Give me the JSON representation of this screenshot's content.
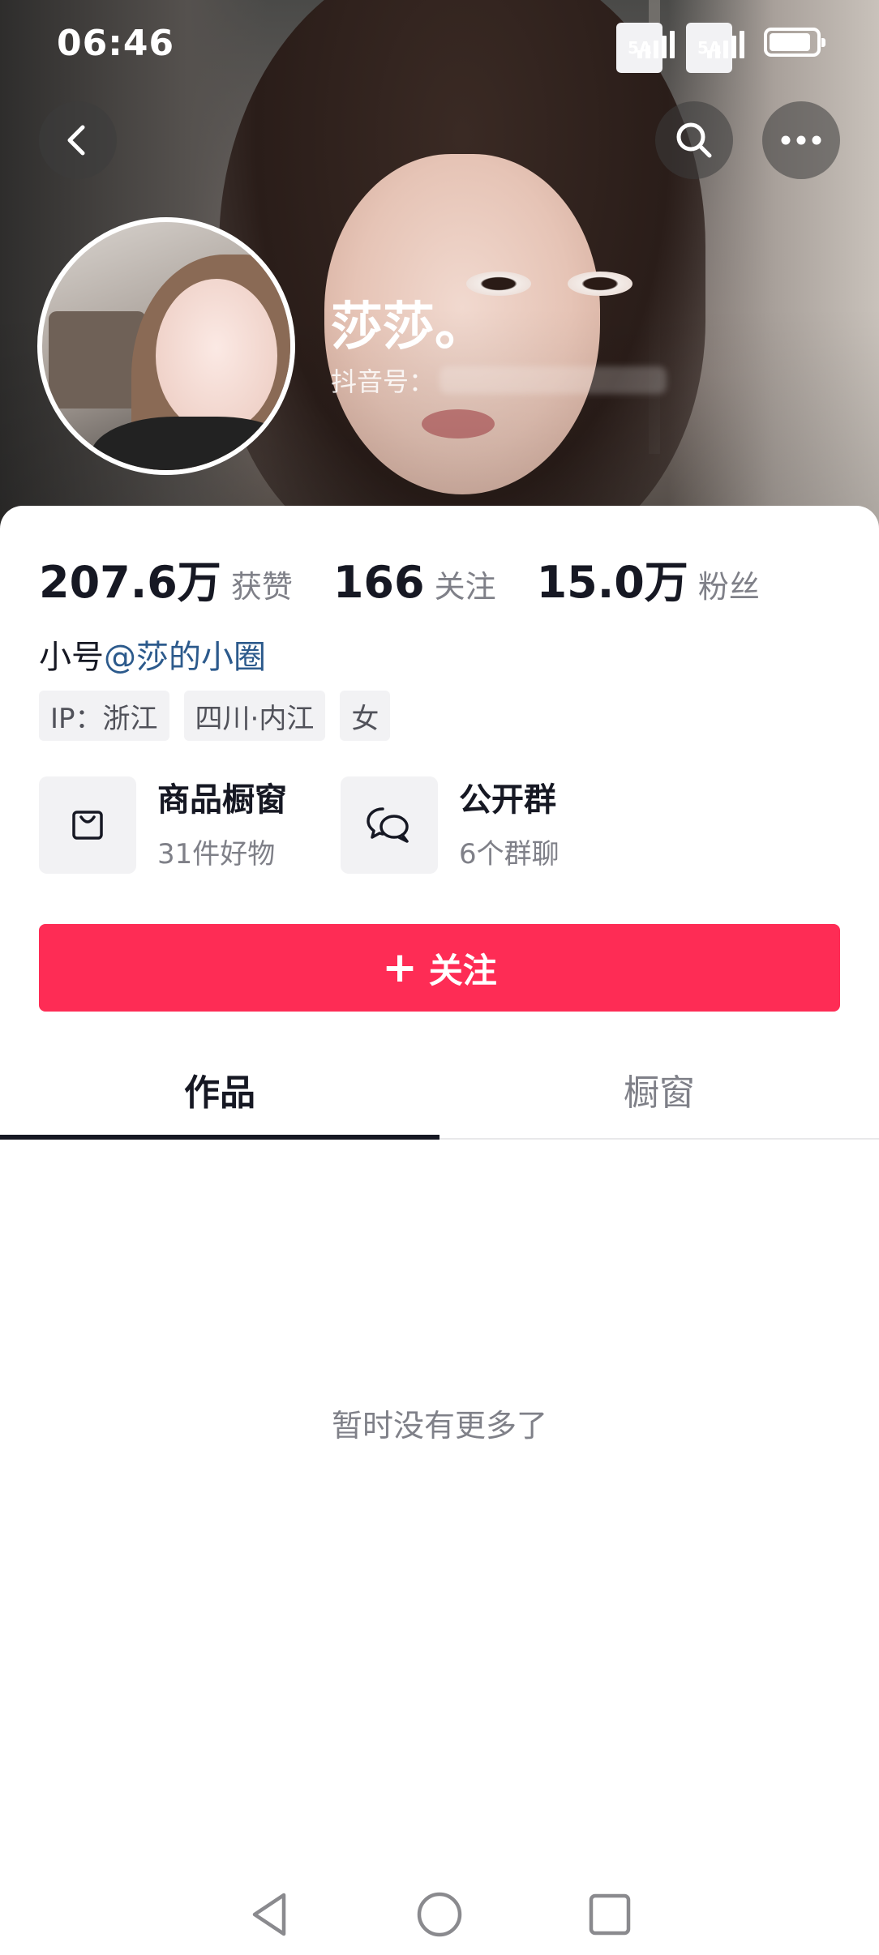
{
  "status_bar": {
    "time": "06:46",
    "sim1_label": "5A",
    "sim2_label": "5A",
    "battery_level": 0.9
  },
  "profile": {
    "name": "莎莎。",
    "douyin_id_label": "抖音号：",
    "stats": [
      {
        "value": "207.6万",
        "label": "获赞"
      },
      {
        "value": "166",
        "label": "关注"
      },
      {
        "value": "15.0万",
        "label": "粉丝"
      }
    ],
    "bio_prefix": "小号",
    "bio_link": "@莎的小圈",
    "tags": [
      "IP：浙江",
      "四川·内江",
      "女"
    ],
    "features": [
      {
        "title": "商品橱窗",
        "subtitle": "31件好物",
        "icon": "shopping-bag-icon"
      },
      {
        "title": "公开群",
        "subtitle": "6个群聊",
        "icon": "chat-bubbles-icon"
      }
    ],
    "follow_button": "关注"
  },
  "tabs": [
    {
      "label": "作品",
      "active": true
    },
    {
      "label": "橱窗",
      "active": false
    }
  ],
  "empty_message": "暂时没有更多了",
  "colors": {
    "accent": "#fe2c55",
    "text_primary": "#161823",
    "text_secondary": "#7f8088",
    "link": "#2c5a8c"
  }
}
